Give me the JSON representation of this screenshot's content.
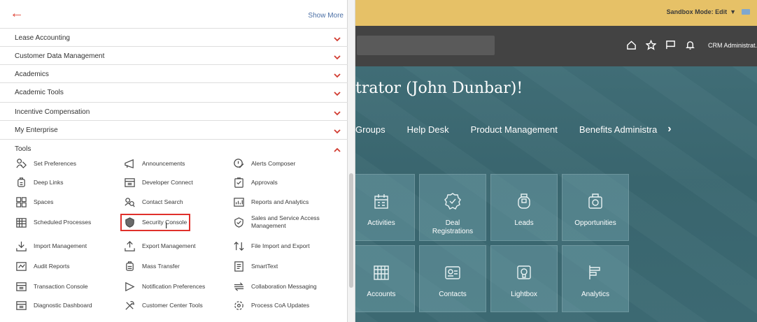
{
  "topbar": {
    "sandbox_label": "Sandbox Mode: Edit",
    "sandbox_caret": "▼"
  },
  "navbar": {
    "user_label": "CRM Administrat..."
  },
  "welcome": {
    "text": "trator (John Dunbar)!"
  },
  "app_tabs": [
    "Groups",
    "Help Desk",
    "Product Management",
    "Benefits Administra"
  ],
  "app_tab_chevron": "›",
  "tiles": [
    {
      "label": "Activities",
      "icon": "calendar-icon"
    },
    {
      "label": "Deal\nRegistrations",
      "icon": "badge-check-icon"
    },
    {
      "label": "Leads",
      "icon": "lead-icon"
    },
    {
      "label": "Opportunities",
      "icon": "opportunity-icon"
    },
    {
      "label": "Accounts",
      "icon": "building-icon"
    },
    {
      "label": "Contacts",
      "icon": "contact-card-icon"
    },
    {
      "label": "Lightbox",
      "icon": "lightbox-icon"
    },
    {
      "label": "Analytics",
      "icon": "analytics-icon"
    }
  ],
  "menu": {
    "back_glyph": "←",
    "show_more": "Show More",
    "groups": [
      "Lease Accounting",
      "Customer Data Management",
      "Academics",
      "Academic Tools",
      "Incentive Compensation",
      "My Enterprise"
    ],
    "tools_label": "Tools",
    "tools": {
      "col1": [
        "Set Preferences",
        "Deep Links",
        "Spaces",
        "Scheduled Processes",
        "Import Management",
        "Audit Reports",
        "Transaction Console",
        "Diagnostic Dashboard"
      ],
      "col2": [
        "Announcements",
        "Developer Connect",
        "Contact Search",
        "Security Console",
        "Export Management",
        "Mass Transfer",
        "Notification Preferences",
        "Customer Center Tools"
      ],
      "col3": [
        "Alerts Composer",
        "Approvals",
        "Reports and Analytics",
        "Sales and Service Access Management",
        "File Import and Export",
        "SmartText",
        "Collaboration Messaging",
        "Process CoA Updates"
      ]
    }
  },
  "colors": {
    "accent": "#d13b30",
    "topbar": "#e6c167",
    "navbar": "#434343",
    "highlight": "#e0302b"
  }
}
